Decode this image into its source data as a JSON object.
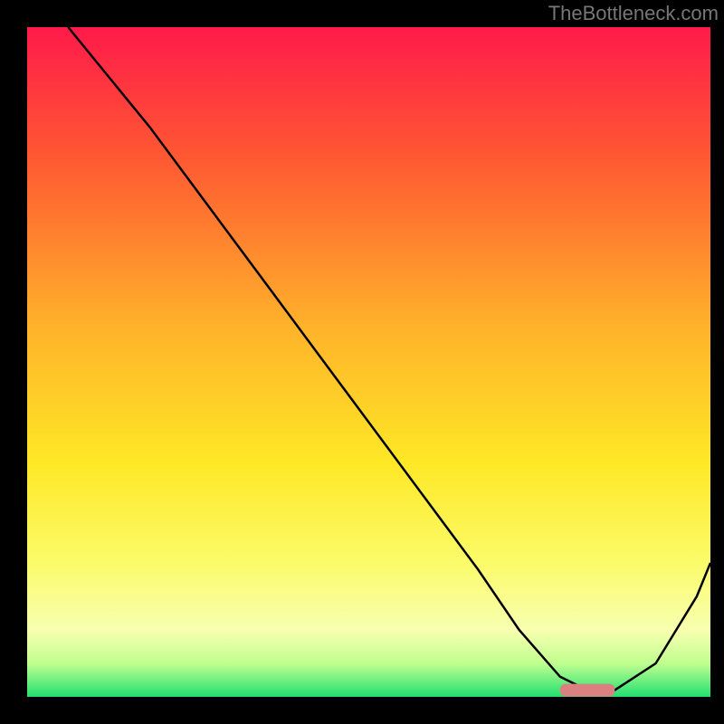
{
  "watermark": "TheBottleneck.com",
  "chart_data": {
    "type": "line",
    "title": "",
    "xlabel": "",
    "ylabel": "",
    "xlim": [
      0,
      100
    ],
    "ylim": [
      0,
      100
    ],
    "grid": false,
    "legend": false,
    "background_gradient": {
      "top": "#ff1a4a",
      "upper_mid": "#ff8a2a",
      "mid": "#fee825",
      "lower_mid": "#fbfb8a",
      "near_bottom": "#d6ffa0",
      "bottom": "#22e070"
    },
    "series": [
      {
        "name": "curve",
        "x": [
          6,
          10,
          18,
          26,
          34,
          42,
          50,
          58,
          66,
          72,
          78,
          82,
          86,
          92,
          98,
          100
        ],
        "y": [
          100,
          95,
          85,
          74,
          63,
          52,
          41,
          30,
          19,
          10,
          3,
          1,
          1,
          5,
          15,
          20
        ]
      }
    ],
    "marker": {
      "x_start": 78,
      "x_end": 86,
      "y": 1,
      "color": "#db8080"
    }
  }
}
